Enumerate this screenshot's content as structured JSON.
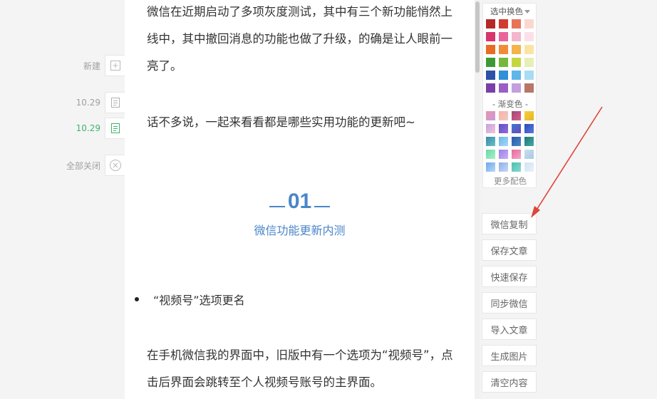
{
  "sidebar": {
    "new_label": "新建",
    "items": [
      {
        "label": "10.29",
        "active": false
      },
      {
        "label": "10.29",
        "active": true
      }
    ],
    "close_all_label": "全部关闭"
  },
  "editor": {
    "para1": "微信在近期启动了多项灰度测试，其中有三个新功能悄然上线中，其中撤回消息的功能也做了升级，的确是让人眼前一亮了。",
    "para2": "话不多说，一起来看看都是哪些实用功能的更新吧~",
    "section_number": "01",
    "section_title": "微信功能更新内测",
    "bullet": "“视频号”选项更名",
    "para3": "在手机微信我的界面中，旧版中有一个选项为“视频号”，点击后界面会跳转至个人视频号账号的主界面。"
  },
  "palette": {
    "header": "选中换色",
    "gradient_header": "- 渐变色 -",
    "more_label": "更多配色",
    "solid_rows": [
      [
        "#b52828",
        "#d33a2f",
        "#e8735a",
        "#fbd7cf"
      ],
      [
        "#d8346d",
        "#e8649a",
        "#f3b6cc",
        "#fbe0ea"
      ],
      [
        "#e86c22",
        "#f08c36",
        "#f6b348",
        "#fbe4a3"
      ],
      [
        "#3c9a35",
        "#76b83c",
        "#c5d73e",
        "#e6efb6"
      ],
      [
        "#2b52a8",
        "#2f8fd8",
        "#5fb6e8",
        "#a8dcf2"
      ],
      [
        "#7a3fa8",
        "#9b5ec6",
        "#c3a0dc",
        "#b8766a"
      ]
    ],
    "gradient_rows": [
      [
        [
          "#e896b0",
          "#c89ad8"
        ],
        [
          "#f7b2a8",
          "#f3c9c2"
        ],
        [
          "#9a4a78",
          "#e05a8a"
        ],
        [
          "#f4d33a",
          "#e8b12a"
        ]
      ],
      [
        [
          "#c6a2e0",
          "#f0c4d8"
        ],
        [
          "#5a50c8",
          "#9a6ad8"
        ],
        [
          "#3a7ad0",
          "#6a4ab8"
        ],
        [
          "#2a4ab8",
          "#5a7ae0"
        ]
      ],
      [
        [
          "#3a8aa8",
          "#6ac0c8"
        ],
        [
          "#68b8e8",
          "#a8d8f4"
        ],
        [
          "#2a5aa8",
          "#4a8ac8"
        ],
        [
          "#1a7a7a",
          "#4aa8a0"
        ]
      ],
      [
        [
          "#6ad8a8",
          "#a8f0c8"
        ],
        [
          "#9a80e8",
          "#c8b0f4"
        ],
        [
          "#e86a9a",
          "#f0a8c8"
        ],
        [
          "#c8e0f0",
          "#a8c8e0"
        ]
      ],
      [
        [
          "#6aa8f0",
          "#b8d8f8"
        ],
        [
          "#8ab0e8",
          "#c8d8f4"
        ],
        [
          "#4ac0b0",
          "#8ad8d0"
        ],
        [
          "#d0e4f4",
          "#e8f0f8"
        ]
      ]
    ]
  },
  "actions": [
    "微信复制",
    "保存文章",
    "快速保存",
    "同步微信",
    "导入文章",
    "生成图片",
    "清空内容"
  ],
  "colors": {
    "accent": "#4a86c8",
    "active_green": "#3fb36b",
    "arrow": "#e0443a"
  }
}
